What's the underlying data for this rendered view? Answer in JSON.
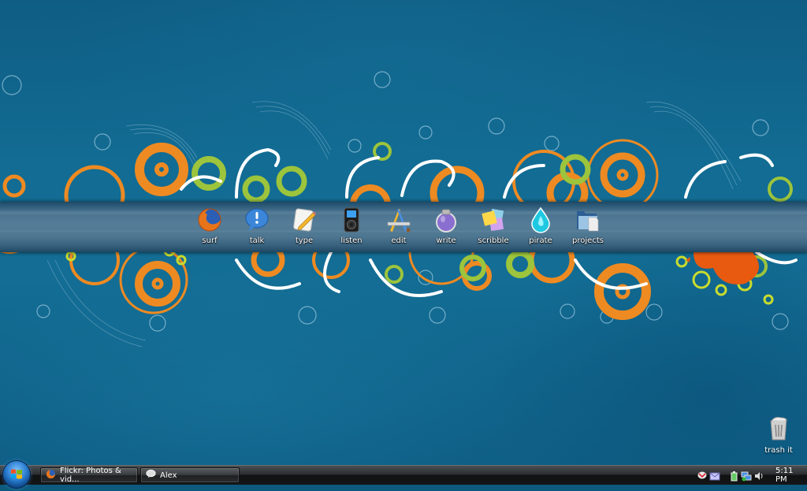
{
  "desktop": {
    "dock_items": [
      {
        "label": "surf",
        "icon": "firefox-icon"
      },
      {
        "label": "talk",
        "icon": "chat-bubble-icon"
      },
      {
        "label": "type",
        "icon": "notepad-pencil-icon"
      },
      {
        "label": "listen",
        "icon": "ipod-icon"
      },
      {
        "label": "edit",
        "icon": "pencil-brush-ruler-icon"
      },
      {
        "label": "write",
        "icon": "ink-bottle-icon"
      },
      {
        "label": "scribble",
        "icon": "sticky-notes-icon"
      },
      {
        "label": "pirate",
        "icon": "water-drop-icon"
      },
      {
        "label": "projects",
        "icon": "folder-icon"
      }
    ],
    "trash": {
      "label": "trash it",
      "icon": "trash-can-icon"
    }
  },
  "taskbar": {
    "start_icon": "windows-start-orb-icon",
    "tasks": [
      {
        "label": "Flickr: Photos & vid...",
        "icon": "firefox-icon"
      },
      {
        "label": "Alex",
        "icon": "chat-bubble-icon"
      }
    ],
    "tray_icons": [
      "gmail-notifier-icon",
      "mail-icon",
      "battery-plug-icon",
      "network-icon",
      "volume-icon"
    ],
    "clock": "5:11 PM"
  },
  "colors": {
    "wallpaper_blue": "#0f5d84",
    "accent_orange": "#ee8a22",
    "accent_green": "#9cc43c",
    "dock_band": "#4d7691"
  }
}
